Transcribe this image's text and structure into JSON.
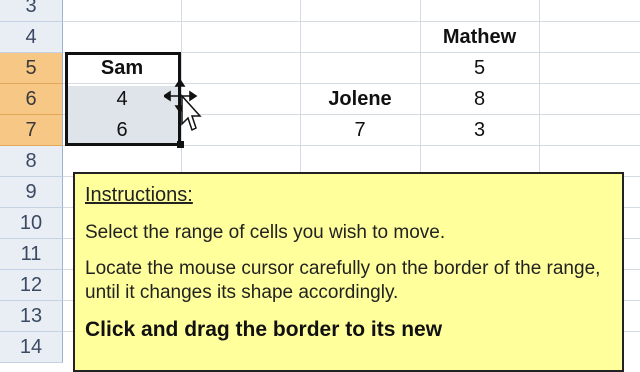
{
  "rows": [
    {
      "num": "3",
      "selected": false
    },
    {
      "num": "4",
      "selected": false
    },
    {
      "num": "5",
      "selected": true
    },
    {
      "num": "6",
      "selected": true
    },
    {
      "num": "7",
      "selected": true
    },
    {
      "num": "8",
      "selected": false
    },
    {
      "num": "9",
      "selected": false
    },
    {
      "num": "10",
      "selected": false
    },
    {
      "num": "11",
      "selected": false
    },
    {
      "num": "12",
      "selected": false
    },
    {
      "num": "13",
      "selected": false
    },
    {
      "num": "14",
      "selected": false
    }
  ],
  "cells": {
    "mathew_header": "Mathew",
    "sam_header": "Sam",
    "mathew_r5": "5",
    "sam_r6": "4",
    "jolene_header": "Jolene",
    "mathew_r6": "8",
    "sam_r7": "6",
    "jolene_r7": "7",
    "mathew_r7": "3"
  },
  "instructions": {
    "title": "Instructions:",
    "line1": "Select the range of cells you wish to move.",
    "line2": "Locate the mouse cursor carefully on the border of the range, until it changes its shape accordingly.",
    "line3": "Click and drag the border to its new"
  },
  "colors": {
    "selected_row_header": "#f7c785",
    "tooltip_background": "#ffff9c"
  },
  "icons": {
    "cursor": "move-cursor-icon"
  }
}
